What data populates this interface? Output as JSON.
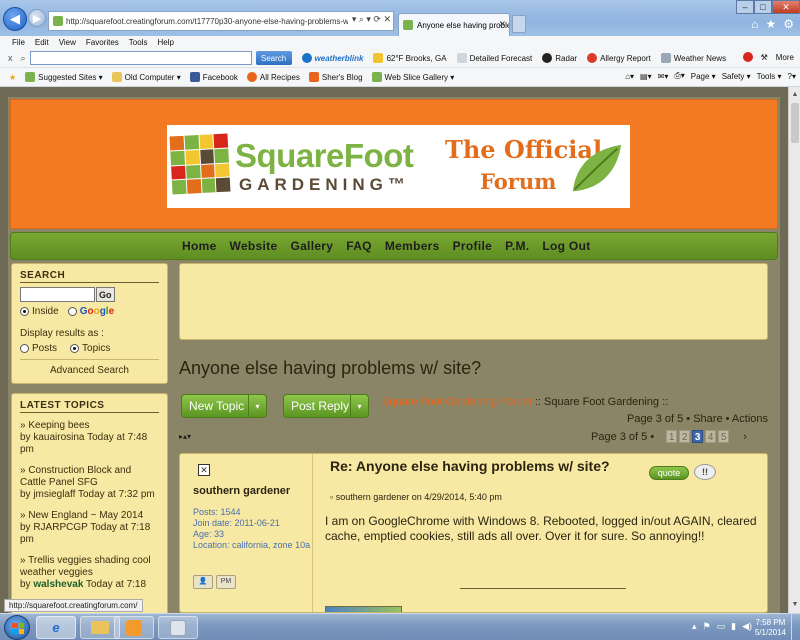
{
  "browser": {
    "address": "http://squarefoot.creatingforum.com/t17770p30-anyone-else-having-problems-w-site",
    "tab_title": "Anyone else having proble...",
    "menu": [
      "File",
      "Edit",
      "View",
      "Favorites",
      "Tools",
      "Help"
    ],
    "toolbar": {
      "search_button": "Search",
      "weatherblink": "weatherblink",
      "weather": "62°F Brooks, GA",
      "detailed_forecast": "Detailed Forecast",
      "radar": "Radar",
      "allergy": "Allergy Report",
      "weather_news": "Weather News",
      "more": "More"
    },
    "favorites": [
      "Suggested Sites ▾",
      "Old Computer ▾",
      "Facebook",
      "All Recipes",
      "Sher's Blog",
      "Web Slice Gallery ▾"
    ],
    "commands": [
      "Page ▾",
      "Safety ▾",
      "Tools ▾"
    ],
    "status_url": "http://squarefoot.creatingforum.com/"
  },
  "site": {
    "logo": {
      "square_foot": "SquareFoot",
      "gardening": "GARDENING™",
      "the_official": "The Official",
      "forum": "Forum"
    },
    "nav": [
      "Home",
      "Website",
      "Gallery",
      "FAQ",
      "Members",
      "Profile",
      "P.M.",
      "Log Out"
    ]
  },
  "sidebar": {
    "search": {
      "title": "SEARCH",
      "go": "Go",
      "inside": "Inside",
      "google": "Google",
      "display_label": "Display results as :",
      "posts": "Posts",
      "topics": "Topics",
      "advanced": "Advanced Search"
    },
    "latest": {
      "title": "LATEST TOPICS",
      "items": [
        {
          "title": "» Keeping bees",
          "by": "by kauairosina Today at 7:48 pm"
        },
        {
          "title": "» Construction Block and Cattle Panel SFG",
          "by": "by jmsieglaff Today at 7:32 pm"
        },
        {
          "title": "» New England ~ May 2014",
          "by": "by RJARPCGP Today at 7:18 pm"
        },
        {
          "title": "» Trellis veggies shading cool weather veggies",
          "by_prefix": "by",
          "by_user": "walshevak",
          "by_time": "Today at 7:18"
        }
      ]
    }
  },
  "main": {
    "topic_title": "Anyone else having problems w/ site?",
    "new_topic": "New Topic",
    "post_reply": "Post Reply",
    "crumb_link": "Square Foot Gardening Forum",
    "crumb_rest": ":: Square Foot Gardening ::",
    "page_info": "Page 3 of 5 • Share • Actions",
    "pager_label": "Page 3 of 5 •",
    "pages": [
      "1",
      "2",
      "3",
      "4",
      "5"
    ],
    "pager_next": "›",
    "arrows": "▸▴▾"
  },
  "post": {
    "author": "southern gardener",
    "stats": [
      "Posts: 1544",
      "Join date: 2011-06-21",
      "Age: 33",
      "Location: california, zone 10a"
    ],
    "title": "Re: Anyone else having problems w/ site?",
    "quote": "quote",
    "report": "!!",
    "meta": "southern gardener on 4/29/2014, 5:40 pm",
    "body": "I am on GoogleChrome with Windows 8. Rebooted, logged in/out AGAIN, cleared cache, emptied cookies, still ads all over.  Over it for sure. So annoying!!"
  },
  "taskbar": {
    "ie": "e",
    "time": "7:58 PM",
    "date": "5/1/2014"
  }
}
